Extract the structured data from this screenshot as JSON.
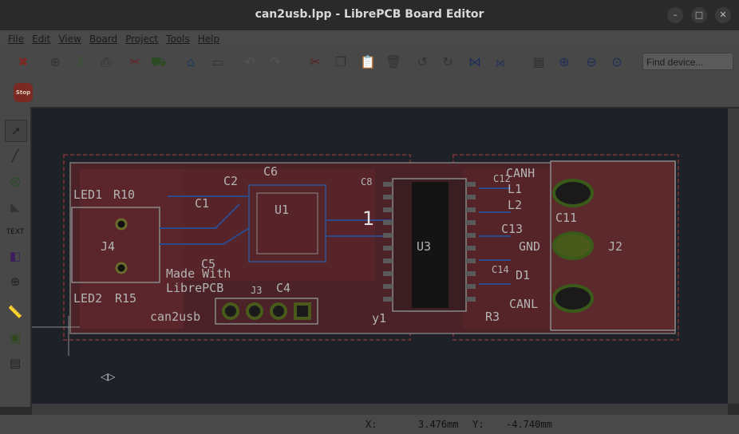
{
  "window": {
    "title": "can2usb.lpp - LibrePCB Board Editor"
  },
  "menu": [
    "File",
    "Edit",
    "View",
    "Board",
    "Project",
    "Tools",
    "Help"
  ],
  "toolbar": {
    "search_placeholder": "Find device...",
    "icons": [
      "close-project-icon",
      "new-icon",
      "export-icon",
      "print-icon",
      "pdf-icon",
      "order-icon",
      "home-icon",
      "schematic-icon",
      "undo-icon",
      "redo-icon",
      "cut-icon",
      "copy-icon",
      "paste-icon",
      "delete-icon",
      "rotate-ccw-icon",
      "rotate-cw-icon",
      "flip-h-icon",
      "flip-v-icon",
      "grid-icon",
      "zoom-in-icon",
      "zoom-out-icon",
      "zoom-fit-icon"
    ],
    "stop_label": "Stop"
  },
  "tools": {
    "text_label": "TEXT"
  },
  "board": {
    "labels": {
      "led1": "LED1",
      "r10": "R10",
      "led2": "LED2",
      "r15": "R15",
      "j4": "J4",
      "c2": "C2",
      "c6": "C6",
      "c1": "C1",
      "u1": "U1",
      "c5": "C5",
      "c4": "C4",
      "y1": "y1",
      "u3": "U3",
      "j3": "J3",
      "made_with": "Made With",
      "librepcb": "LibrePCB",
      "can2usb": "can2usb",
      "canh": "CANH",
      "canl": "CANL",
      "gnd": "GND",
      "c11": "C11",
      "c13": "C13",
      "l1": "L1",
      "l2": "L2",
      "d1": "D1",
      "r3": "R3",
      "j2": "J2",
      "c12": "C12",
      "c14": "C14",
      "c8": "C8",
      "cursor_num": "1"
    }
  },
  "status": {
    "x_label": "X:",
    "x_value": "3.476mm",
    "y_label": "Y:",
    "y_value": "-4.740mm"
  }
}
